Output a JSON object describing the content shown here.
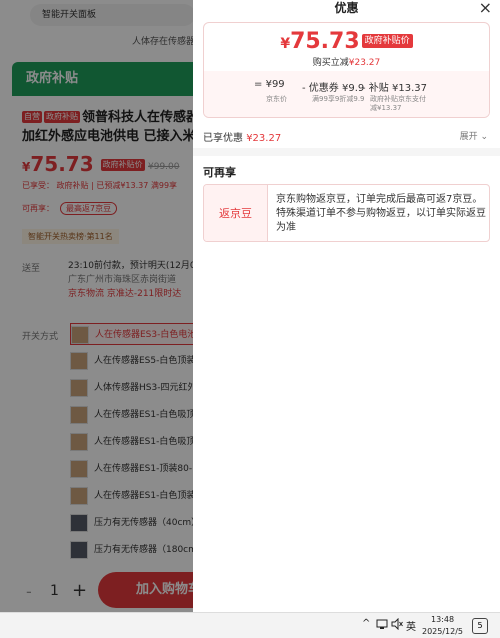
{
  "background": {
    "search_text": "智能开关面板",
    "stock_text": "人体存在传感器",
    "banner_title": "政府补贴",
    "title_tags": [
      "自营",
      "政府补贴"
    ],
    "product_title": "领普科技人在传感器 加红外感应电池供电 已接入米",
    "price_symbol": "¥",
    "price": "75.73",
    "price_tag": "政府补贴价",
    "original_price": "¥99.00",
    "discount_line": "已享受：  政府补贴 | 已预减¥13.37  满99享",
    "rebuy_label": "可再享：",
    "rebuy_pill": "最高返7京豆",
    "rank_text": "智能开关热卖榜·第11名",
    "deliver_label": "送至",
    "deliver_time": "23:10前付款，预计明天(12月0",
    "deliver_address": "广东广州市海珠区赤岗街道",
    "deliver_service": "京东物流  京准达-211限时达",
    "options_label": "开关方式",
    "options": [
      {
        "label": "人在传感器ES3-白色电池"
      },
      {
        "label": "人在传感器ES5-白色顶装"
      },
      {
        "label": "人体传感器HS3-四元红外"
      },
      {
        "label": "人在传感器ES1-白色吸顶"
      },
      {
        "label": "人在传感器ES1-白色吸顶"
      },
      {
        "label": "人在传感器ES1-顶装80-"
      },
      {
        "label": "人在传感器ES1-白色顶装"
      },
      {
        "label": "压力有无传感器（40cm）"
      },
      {
        "label": "压力有无传感器（180cm"
      }
    ],
    "qty_minus": "-",
    "quantity": "1",
    "qty_plus": "+",
    "add_to_cart": "加入购物车"
  },
  "panel": {
    "title": "优惠",
    "close_glyph": "×",
    "card": {
      "price_symbol": "¥",
      "price": "75.73",
      "price_tag": "政府补贴价",
      "sub_label": "购买立减",
      "sub_value": "¥23.27",
      "calc": [
        {
          "op": "=",
          "value": "¥99",
          "note": "京东价"
        },
        {
          "op": "- 优惠券",
          "value": "¥9.9",
          "note": "满99享9折减9.9"
        },
        {
          "op": "- 补贴",
          "value": "¥13.37",
          "note": "政府补贴京东支付\n减¥13.37"
        }
      ]
    },
    "shared_label": "已享优惠",
    "shared_value": "¥23.27",
    "expand_label": "展开",
    "section_title": "可再享",
    "benefit": {
      "label": "返京豆",
      "text": "京东购物返京豆，订单完成后最高可返7京豆。特殊渠道订单不参与购物返豆，以订单实际返豆为准"
    }
  },
  "taskbar": {
    "chevron": "^",
    "ime": "英",
    "time": "13:48",
    "date": "2025/12/5",
    "notif_count": "5"
  }
}
